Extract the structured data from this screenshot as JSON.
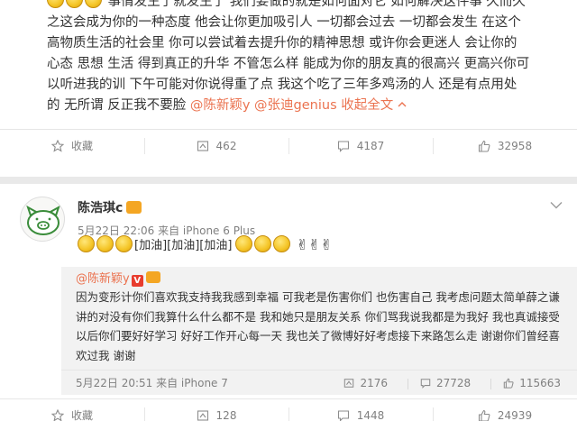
{
  "top_post": {
    "lines": [
      "事情发生了就发生了 我们要做的就是如何面对它 如何解决这件事 久而久",
      "之这会成为你的一种态度 他会让你更加吸引人 一切都会过去 一切都会发生 在这个",
      "高物质生活的社会里 你可以尝试着去提升你的精神思想 或许你会更迷人 会让你的",
      "心态 思想 生活 得到真正的升华 不管怎么样 能成为你的朋友真的很高兴 更高兴你可",
      "以听进我的训 下午可能对你说得重了点 我这个吃了三年多鸡汤的人 还是有点用处",
      "的 无所谓 反正我不要脸"
    ],
    "mention_1": "@陈新颖y",
    "mention_2": "@张迪genius",
    "expand": "收起全文",
    "actions": {
      "favorite": "收藏",
      "repost": "462",
      "comment": "4187",
      "like": "32958"
    }
  },
  "bottom_post": {
    "author": "陈浩琪c",
    "meta": "5月22日 22:06 来自 iPhone 6 Plus",
    "text": "[加油][加油][加油]",
    "repost": {
      "author": "@陈新颖y",
      "verified": "V",
      "body": "因为变形计你们喜欢我支持我我感到幸福 可我老是伤害你们 也伤害自己 我考虑问题太简单薛之谦讲的对没有你们我算什么什么都不是 我和她只是朋友关系 你们骂我说我都是为我好 我也真诚接受以后你们要好好学习 好好工作开心每一天 我也关了微博好好考虑接下来路怎么走 谢谢你们曾经喜欢过我 谢谢",
      "time": "5月22日 20:51 来自 iPhone 7",
      "repost_count": "2176",
      "comment_count": "27728",
      "like_count": "115663"
    },
    "actions": {
      "favorite": "收藏",
      "repost": "128",
      "comment": "1448",
      "like": "24939"
    }
  }
}
